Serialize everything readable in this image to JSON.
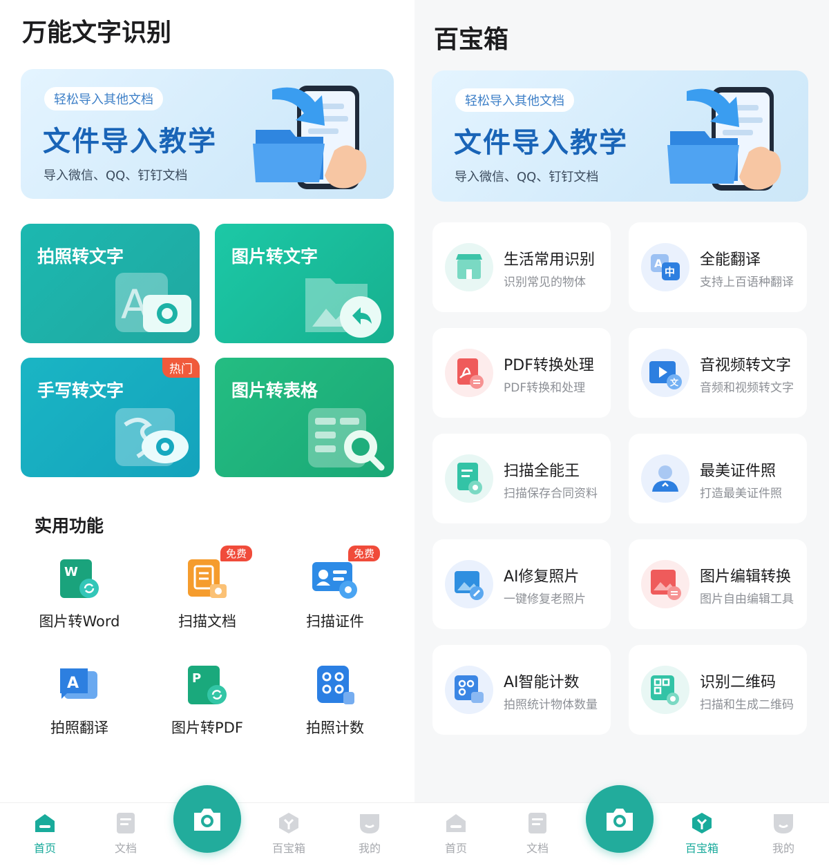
{
  "left": {
    "title": "万能文字识别",
    "banner": {
      "tag": "轻松导入其他文档",
      "headline": "文件导入教学",
      "sub": "导入微信、QQ、钉钉文档"
    },
    "tiles": [
      {
        "label": "拍照转文字"
      },
      {
        "label": "图片转文字"
      },
      {
        "label": "手写转文字",
        "badge": "热门"
      },
      {
        "label": "图片转表格"
      }
    ],
    "section_title": "实用功能",
    "utilities": [
      {
        "label": "图片转Word",
        "icon": "word-convert-icon"
      },
      {
        "label": "扫描文档",
        "icon": "scan-document-icon",
        "badge": "免费"
      },
      {
        "label": "扫描证件",
        "icon": "scan-id-card-icon",
        "badge": "免费"
      },
      {
        "label": "拍照翻译",
        "icon": "photo-translate-icon"
      },
      {
        "label": "图片转PDF",
        "icon": "pdf-convert-icon"
      },
      {
        "label": "拍照计数",
        "icon": "photo-count-icon"
      }
    ],
    "nav": [
      "首页",
      "文档",
      "百宝箱",
      "我的"
    ]
  },
  "right": {
    "title": "百宝箱",
    "banner": {
      "tag": "轻松导入其他文档",
      "headline": "文件导入教学",
      "sub": "导入微信、QQ、钉钉文档"
    },
    "cards": [
      {
        "title": "生活常用识别",
        "sub": "识别常见的物体",
        "icon": "store-icon"
      },
      {
        "title": "全能翻译",
        "sub": "支持上百语种翻译",
        "icon": "translate-icon"
      },
      {
        "title": "PDF转换处理",
        "sub": "PDF转换和处理",
        "icon": "pdf-icon"
      },
      {
        "title": "音视频转文字",
        "sub": "音频和视频转文字",
        "icon": "video-text-icon"
      },
      {
        "title": "扫描全能王",
        "sub": "扫描保存合同资料",
        "icon": "scan-file-icon"
      },
      {
        "title": "最美证件照",
        "sub": "打造最美证件照",
        "icon": "id-photo-icon"
      },
      {
        "title": "AI修复照片",
        "sub": "一键修复老照片",
        "icon": "photo-repair-icon"
      },
      {
        "title": "图片编辑转换",
        "sub": "图片自由编辑工具",
        "icon": "image-edit-icon"
      },
      {
        "title": "AI智能计数",
        "sub": "拍照统计物体数量",
        "icon": "ai-count-icon"
      },
      {
        "title": "识别二维码",
        "sub": "扫描和生成二维码",
        "icon": "qr-code-icon"
      }
    ],
    "nav": [
      "首页",
      "文档",
      "百宝箱",
      "我的"
    ]
  },
  "colors": {
    "accent": "#17a99a",
    "banner_text": "#1964b7",
    "hot_badge": "#f05a3b",
    "free_badge": "#f04b3a"
  }
}
